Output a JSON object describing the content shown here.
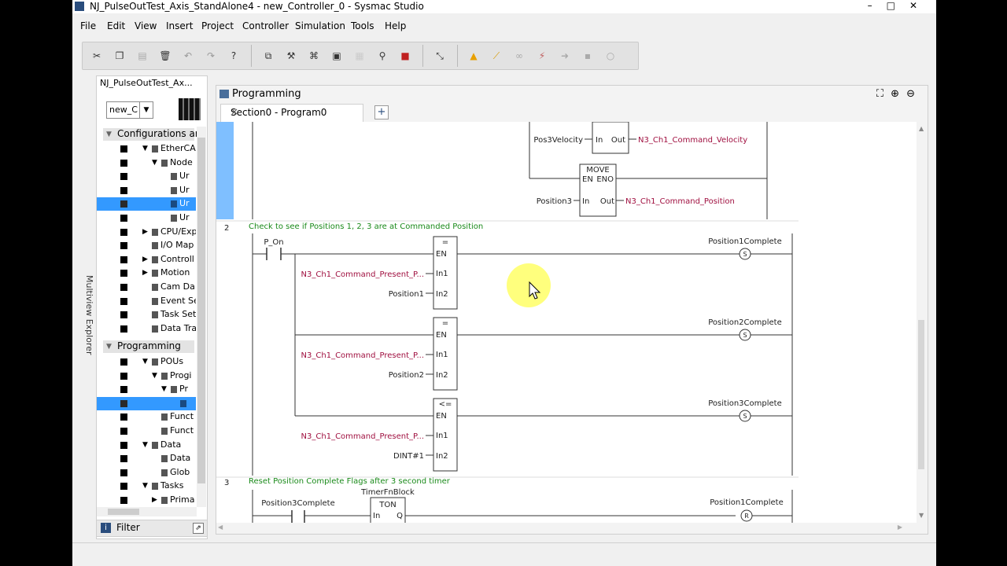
{
  "window": {
    "title": "NJ_PulseOutTest_Axis_StandAlone4 - new_Controller_0 - Sysmac Studio",
    "controls": [
      "–",
      "□",
      "✕"
    ]
  },
  "menu": [
    "File",
    "Edit",
    "View",
    "Insert",
    "Project",
    "Controller",
    "Simulation",
    "Tools",
    "Help"
  ],
  "toolbar": {
    "icons": [
      "cut-icon",
      "copy-icon",
      "paste-icon",
      "delete-icon",
      "undo-icon",
      "redo-icon",
      "help-icon",
      "build-icon",
      "tool-icon",
      "network-icon",
      "monitor-icon",
      "disabled-icon",
      "search-icon",
      "stop-icon",
      "cross-ref-icon",
      "warning-icon",
      "clear-icon",
      "link-icon",
      "unlink-icon",
      "step-icon",
      "view-icon",
      "refresh-icon"
    ]
  },
  "explorer": {
    "project": "NJ_PulseOutTest_Ax...",
    "controller_select": "new_C",
    "vertical_label": "Multiview Explorer",
    "config_header": "Configurations ar",
    "programming_header": "Programming",
    "filter_label": "Filter",
    "config_items": [
      {
        "label": "EtherCA",
        "indent": 1,
        "expand": "▼"
      },
      {
        "label": "Node",
        "indent": 2,
        "expand": "▼"
      },
      {
        "label": "Ur",
        "indent": 3,
        "expand": ""
      },
      {
        "label": "Ur",
        "indent": 3,
        "expand": ""
      },
      {
        "label": "Ur",
        "indent": 3,
        "expand": "",
        "selected": true
      },
      {
        "label": "Ur",
        "indent": 3,
        "expand": ""
      },
      {
        "label": "CPU/Exp",
        "indent": 1,
        "expand": "▶"
      },
      {
        "label": "I/O Map",
        "indent": 1,
        "expand": ""
      },
      {
        "label": "Controll",
        "indent": 1,
        "expand": "▶"
      },
      {
        "label": "Motion",
        "indent": 1,
        "expand": "▶"
      },
      {
        "label": "Cam Da",
        "indent": 1,
        "expand": ""
      },
      {
        "label": "Event Se",
        "indent": 1,
        "expand": ""
      },
      {
        "label": "Task Set",
        "indent": 1,
        "expand": ""
      },
      {
        "label": "Data Tra",
        "indent": 1,
        "expand": ""
      }
    ],
    "prog_items": [
      {
        "label": "POUs",
        "indent": 1,
        "expand": "▼"
      },
      {
        "label": "Progi",
        "indent": 2,
        "expand": "▼"
      },
      {
        "label": "Pr",
        "indent": 3,
        "expand": "▼"
      },
      {
        "label": "",
        "indent": 4,
        "expand": "",
        "selected": true
      },
      {
        "label": "Funct",
        "indent": 2,
        "expand": ""
      },
      {
        "label": "Funct",
        "indent": 2,
        "expand": ""
      },
      {
        "label": "Data",
        "indent": 1,
        "expand": "▼"
      },
      {
        "label": "Data",
        "indent": 2,
        "expand": ""
      },
      {
        "label": "Glob",
        "indent": 2,
        "expand": ""
      },
      {
        "label": "Tasks",
        "indent": 1,
        "expand": "▼"
      },
      {
        "label": "Prima",
        "indent": 2,
        "expand": "▶"
      }
    ]
  },
  "programming": {
    "title": "Programming",
    "tab": "Section0 - Program0",
    "tab_close": "×",
    "add_tab": "+",
    "zoom_icons": [
      "fit-icon",
      "zoom-in-icon",
      "zoom-out-icon"
    ]
  },
  "ladder": {
    "rung1": {
      "move_label": "MOVE",
      "en": "EN",
      "eno": "ENO",
      "in": "In",
      "out": "Out",
      "pos3velocity": "Pos3Velocity",
      "velocity_out": "N3_Ch1_Command_Velocity",
      "position3": "Position3",
      "position_out": "N3_Ch1_Command_Position"
    },
    "rung2": {
      "number": "2",
      "comment": "Check to see if Positions 1, 2, 3 are at Commanded Position",
      "contact": "P_On",
      "blocks": [
        {
          "op": "=",
          "in1": "N3_Ch1_Command_Present_P...",
          "in2": "Position1",
          "coil": "Position1Complete"
        },
        {
          "op": "=",
          "in1": "N3_Ch1_Command_Present_P...",
          "in2": "Position2",
          "coil": "Position2Complete"
        },
        {
          "op": "<=",
          "in1": "N3_Ch1_Command_Present_P...",
          "in2": "DINT#1",
          "coil": "Position3Complete"
        }
      ],
      "en": "EN",
      "in1_pin": "In1",
      "in2_pin": "In2",
      "coil_type": "S"
    },
    "rung3": {
      "number": "3",
      "comment": "Reset Position Complete Flags after 3 second timer",
      "contact": "Position3Complete",
      "timer_instance": "TimerFnBlock",
      "timer_type": "TON",
      "timer_in": "In",
      "timer_q": "Q",
      "coil": "Position1Complete",
      "coil_type": "R"
    }
  },
  "colors": {
    "variable": "#a01040",
    "comment": "#1a8a1a",
    "rung_bar": "#7fbfff",
    "selection": "#3399ff",
    "highlight": "#ffff66"
  }
}
